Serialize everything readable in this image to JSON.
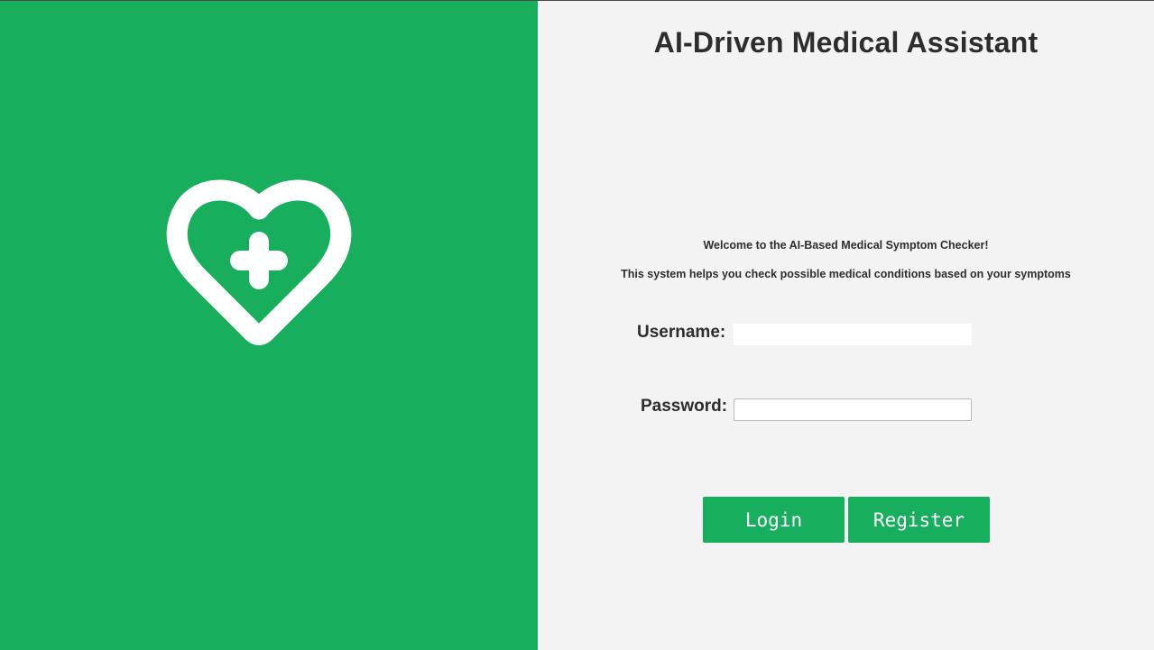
{
  "brand": {
    "panel_color": "#17ae5d",
    "logo_icon": "heart-plus-icon"
  },
  "header": {
    "title": "AI-Driven Medical Assistant"
  },
  "intro": {
    "welcome": "Welcome to the AI-Based Medical Symptom Checker!",
    "description": "This system helps you check possible medical conditions based on your symptoms"
  },
  "form": {
    "username_label": "Username:",
    "username_value": "",
    "password_label": "Password:",
    "password_value": ""
  },
  "actions": {
    "login_label": "Login",
    "register_label": "Register"
  }
}
